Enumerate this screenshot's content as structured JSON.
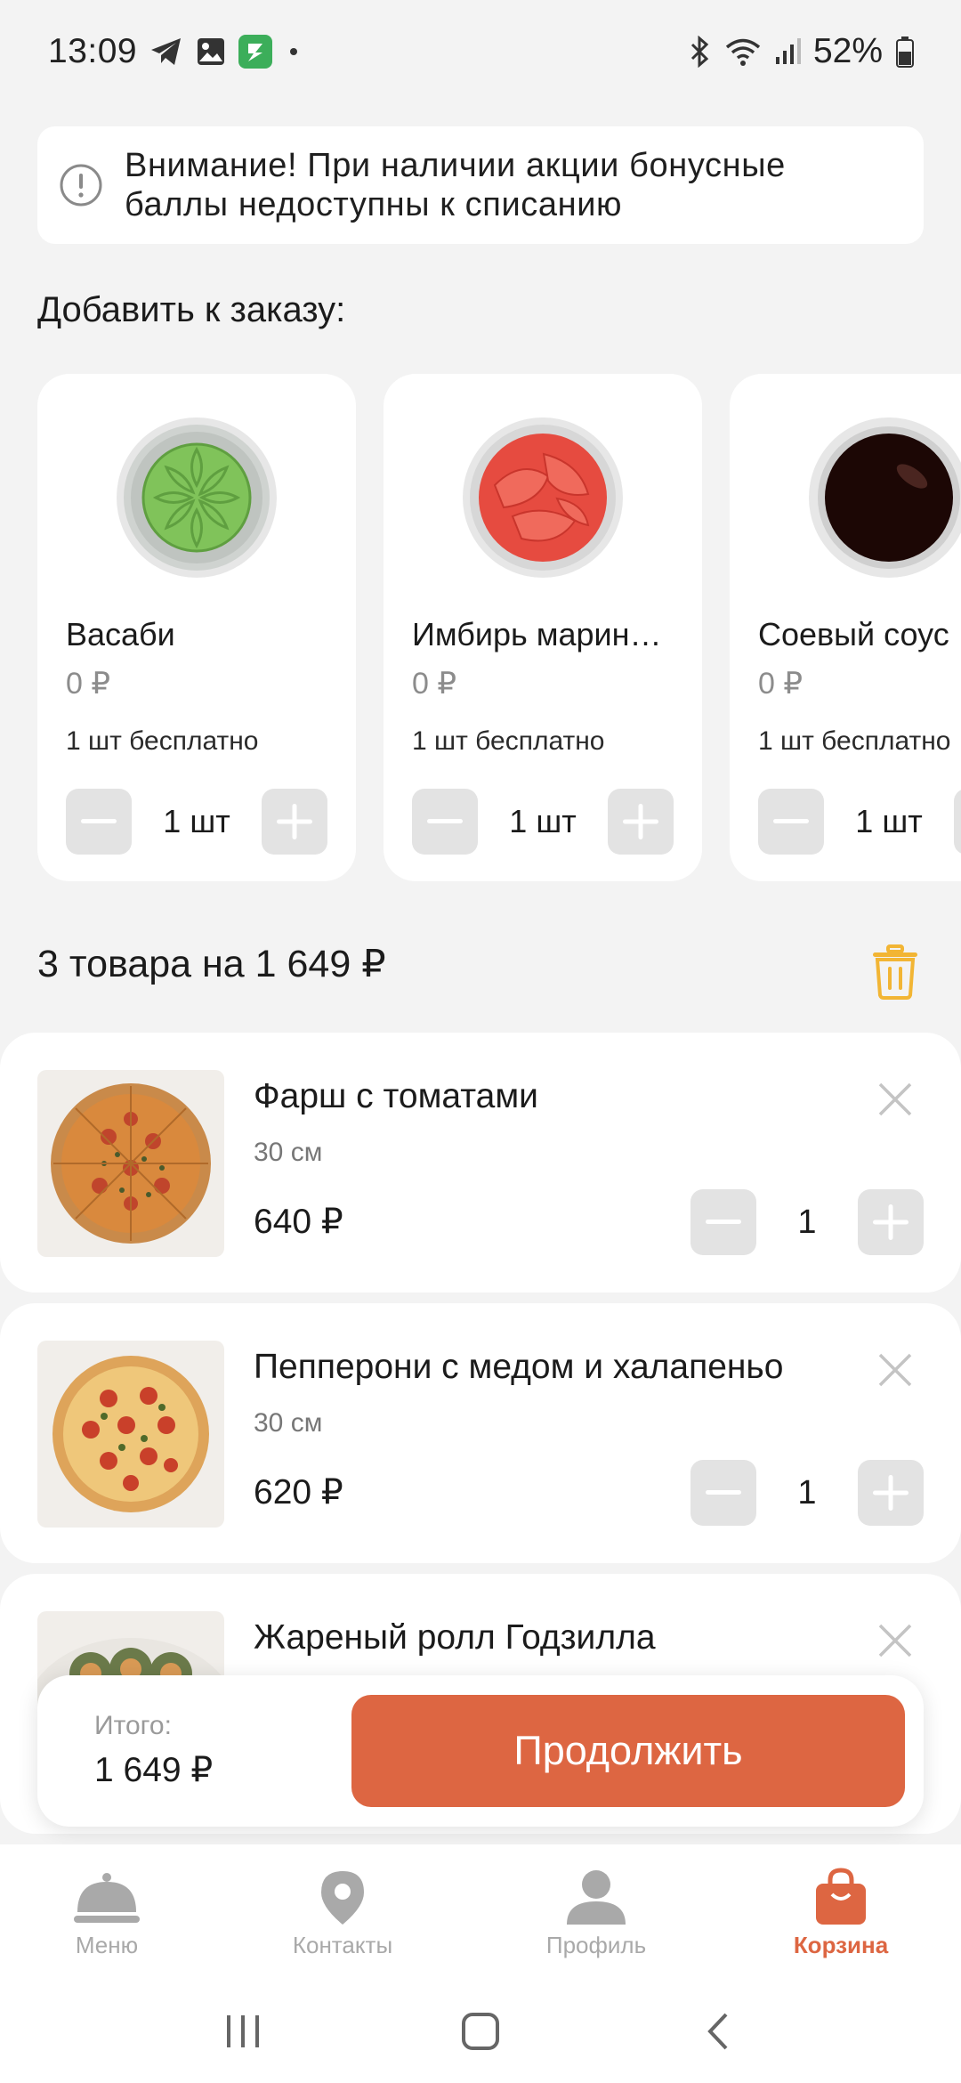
{
  "status_bar": {
    "time": "13:09",
    "battery": "52%",
    "icons": [
      "telegram-icon",
      "gallery-icon",
      "app-icon",
      "dot-icon",
      "bluetooth-icon",
      "wifi-icon",
      "signal-icon",
      "battery-icon"
    ]
  },
  "notice": {
    "line1": "Внимание! При наличии акции бонусные",
    "line2": "баллы недоступны к списанию",
    "icon": "info-icon"
  },
  "addons": {
    "title": "Добавить к заказу:",
    "items": [
      {
        "name": "Васаби",
        "price": "0 ₽",
        "note": "1 шт бесплатно",
        "qty": "1 шт",
        "color": "#7fbf57"
      },
      {
        "name": "Имбирь марин…",
        "price": "0 ₽",
        "note": "1 шт бесплатно",
        "qty": "1 шт",
        "color": "#e8473f"
      },
      {
        "name": "Соевый соус",
        "price": "0 ₽",
        "note": "1 шт бесплатно",
        "qty": "1 шт",
        "color": "#2a0d0a"
      }
    ]
  },
  "cart": {
    "summary": "3 товара на 1 649 ₽",
    "items": [
      {
        "name": "Фарш с томатами",
        "size": "30 см",
        "price": "640 ₽",
        "qty": "1"
      },
      {
        "name": "Пепперони с медом и халапеньо",
        "size": "30 см",
        "price": "620 ₽",
        "qty": "1"
      },
      {
        "name": "Жареный ролл Годзилла"
      }
    ]
  },
  "checkout": {
    "total_label": "Итого:",
    "total_value": "1 649 ₽",
    "button": "Продолжить"
  },
  "nav": {
    "items": [
      {
        "label": "Меню",
        "icon": "cloche-icon"
      },
      {
        "label": "Контакты",
        "icon": "location-pin-icon"
      },
      {
        "label": "Профиль",
        "icon": "person-icon"
      },
      {
        "label": "Корзина",
        "icon": "shopping-bag-icon",
        "active": true
      }
    ]
  },
  "colors": {
    "accent": "#dd6642",
    "trash": "#f2b534",
    "muted": "#a9a9a9"
  }
}
